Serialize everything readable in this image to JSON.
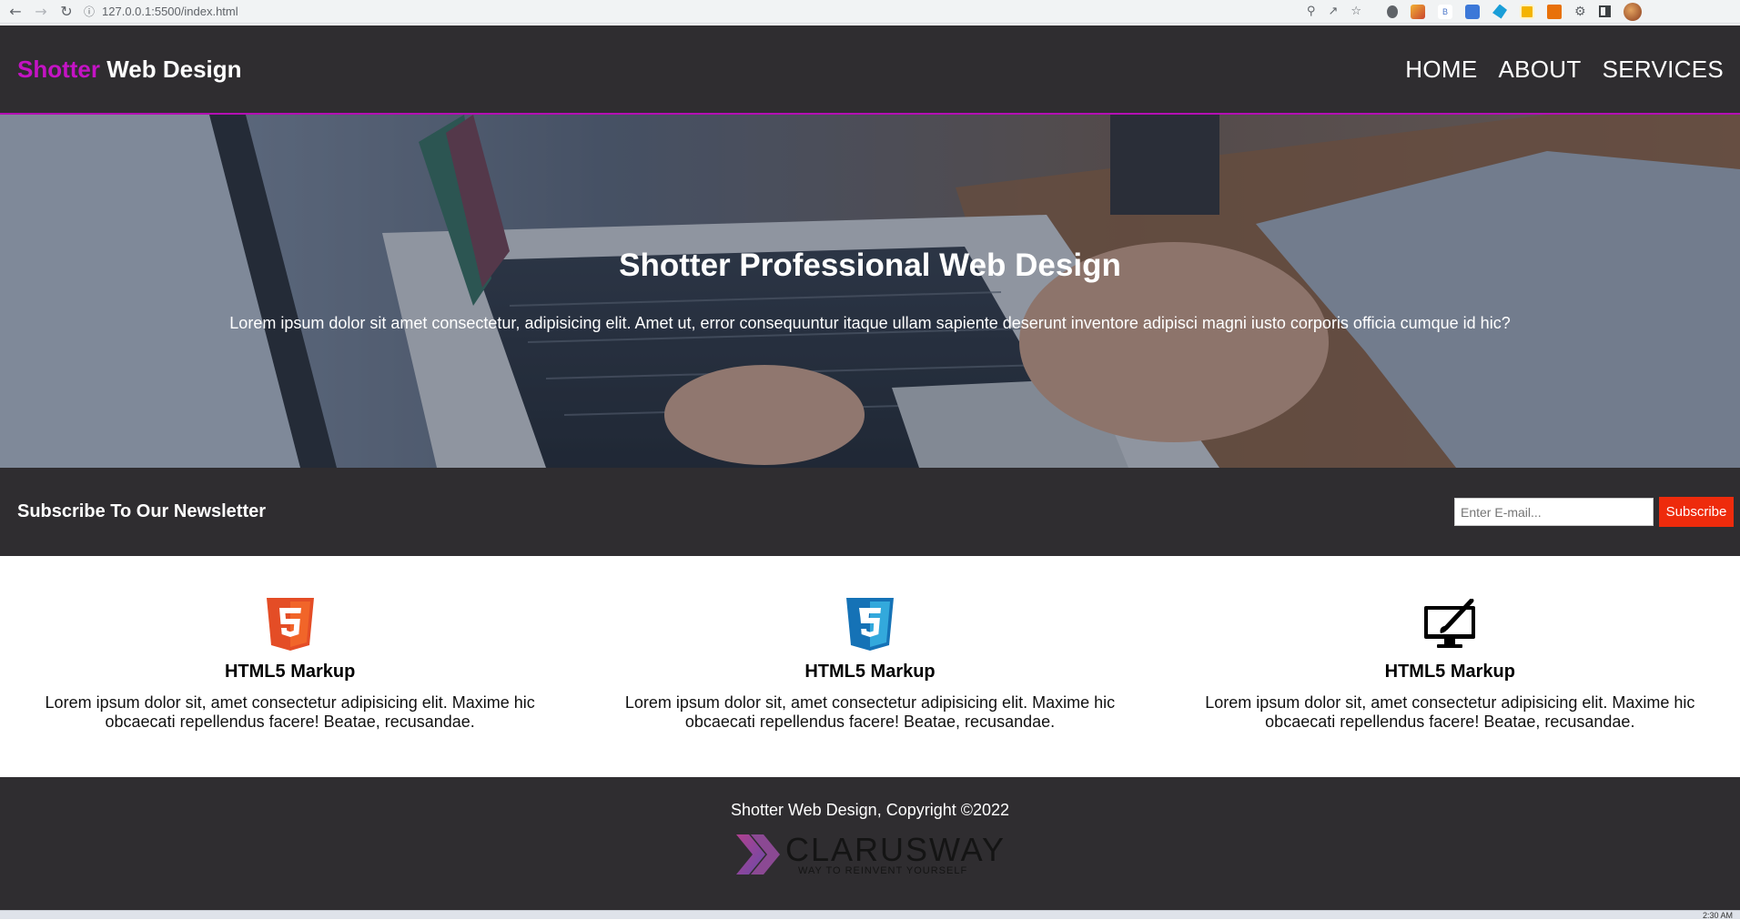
{
  "browser": {
    "url": "127.0.0.1:5500/index.html",
    "icons": [
      "back-icon",
      "forward-icon",
      "reload-icon",
      "info-icon",
      "zoom-icon",
      "share-icon",
      "bookmark-star-icon",
      "extensions-icon",
      "side-panel-icon",
      "profile-avatar"
    ]
  },
  "header": {
    "logo_accent": "Shotter",
    "logo_rest": " Web Design",
    "nav": [
      "HOME",
      "ABOUT",
      "SERVICES"
    ]
  },
  "hero": {
    "title": "Shotter Professional Web Design",
    "text": "Lorem ipsum dolor sit amet consectetur, adipisicing elit. Amet ut, error consequuntur itaque ullam sapiente deserunt inventore adipisci magni iusto corporis officia cumque id hic?"
  },
  "newsletter": {
    "title": "Subscribe To Our Newsletter",
    "email_placeholder": "Enter E-mail...",
    "button": "Subscribe"
  },
  "features": [
    {
      "icon": "html5-icon",
      "title": "HTML5 Markup",
      "text": "Lorem ipsum dolor sit, amet consectetur adipisicing elit. Maxime hic obcaecati repellendus facere! Beatae, recusandae."
    },
    {
      "icon": "css3-icon",
      "title": "HTML5 Markup",
      "text": "Lorem ipsum dolor sit, amet consectetur adipisicing elit. Maxime hic obcaecati repellendus facere! Beatae, recusandae."
    },
    {
      "icon": "monitor-brush-icon",
      "title": "HTML5 Markup",
      "text": "Lorem ipsum dolor sit, amet consectetur adipisicing elit. Maxime hic obcaecati repellendus facere! Beatae, recusandae."
    }
  ],
  "footer": {
    "copyright": "Shotter Web Design, Copyright ©2022",
    "brand_name": "CLARUSWAY",
    "brand_tagline": "WAY TO REINVENT YOURSELF"
  },
  "taskbar": {
    "clock": "2:30 AM"
  },
  "colors": {
    "header_bg": "#2f2d30",
    "accent_purple": "#c413c4",
    "subscribe_red": "#ee2b0c",
    "html5_orange": "#e44d26",
    "css3_blue": "#1572b6"
  }
}
